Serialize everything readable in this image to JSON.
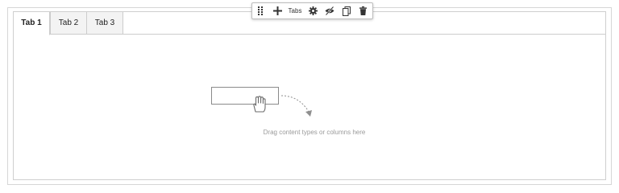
{
  "tabs": [
    {
      "label": "Tab 1",
      "active": true
    },
    {
      "label": "Tab 2",
      "active": false
    },
    {
      "label": "Tab 3",
      "active": false
    }
  ],
  "toolbar": {
    "label": "Tabs",
    "icons": [
      "drag-handle-icon",
      "plus-icon",
      "gear-icon",
      "eye-slash-icon",
      "copy-icon",
      "trash-icon"
    ]
  },
  "empty_state": {
    "hint": "Drag content types or columns here"
  },
  "colors": {
    "border": "#cccccc",
    "tab_inactive_bg": "#f3f3f3",
    "hint_text": "#9a9a9a",
    "icon": "#333333"
  }
}
